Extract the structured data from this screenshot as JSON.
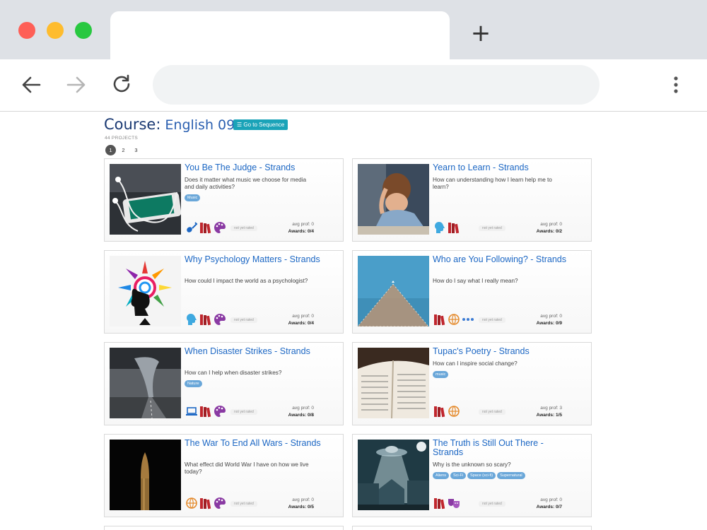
{
  "course": {
    "label": "Course:",
    "name": "English 09",
    "sequence_button": "☰ Go to Sequence",
    "project_count": "44 PROJECTS"
  },
  "pagination": [
    "1",
    "2",
    "3"
  ],
  "cards": [
    {
      "title": "You Be The Judge - Strands",
      "question": "Does it matter what music we choose for media and daily activities?",
      "tags": [
        "Music"
      ],
      "icons": [
        "guitar-icon",
        "books-icon",
        "palette-icon"
      ],
      "status": "not yet rated",
      "avg_prof": "avg prof: 0",
      "awards": "Awards: 0/4"
    },
    {
      "title": "Yearn to Learn - Strands",
      "question": "How can understanding how I learn help me to learn?",
      "tags": [],
      "icons": [
        "head-icon",
        "books-icon"
      ],
      "status": "not yet rated",
      "avg_prof": "avg prof: 0",
      "awards": "Awards: 0/2"
    },
    {
      "title": "Why Psychology Matters - Strands",
      "question": "How could I impact the world as a psychologist?",
      "tags": [],
      "icons": [
        "head-icon",
        "books-icon",
        "palette-icon"
      ],
      "status": "not yet rated",
      "avg_prof": "avg prof: 0",
      "awards": "Awards: 0/4"
    },
    {
      "title": "Who are You Following? - Strands",
      "question": "How do I say what I really mean?",
      "tags": [],
      "icons": [
        "books-icon",
        "globe-icon",
        "more-icon"
      ],
      "status": "not yet rated",
      "avg_prof": "avg prof: 0",
      "awards": "Awards: 0/9"
    },
    {
      "title": "When Disaster Strikes - Strands",
      "question": "How can I help when disaster strikes?",
      "tags": [
        "Nature"
      ],
      "icons": [
        "laptop-icon",
        "books-icon",
        "palette-icon"
      ],
      "status": "not yet rated",
      "avg_prof": "avg prof: 0",
      "awards": "Awards: 0/8"
    },
    {
      "title": "Tupac's Poetry - Strands",
      "question": "How can I inspire social change?",
      "tags": [
        "music"
      ],
      "icons": [
        "books-icon",
        "globe-icon"
      ],
      "status": "not yet rated",
      "avg_prof": "avg prof: 3",
      "awards": "Awards: 1/5"
    },
    {
      "title": "The War To End All Wars - Strands",
      "question": "What effect did World War I have on how we live today?",
      "tags": [],
      "icons": [
        "globe-icon",
        "books-icon",
        "palette-icon"
      ],
      "status": "not yet rated",
      "avg_prof": "avg prof: 0",
      "awards": "Awards: 0/5"
    },
    {
      "title": "The Truth is Still Out There - Strands",
      "question": "Why is the unknown so scary?",
      "tags": [
        "Aliens",
        "Sci-Fi",
        "Space (sci-fi)",
        "Supernatural"
      ],
      "icons": [
        "books-icon",
        "theater-masks-icon"
      ],
      "status": "not yet rated",
      "avg_prof": "avg prof: 0",
      "awards": "Awards: 0/7"
    }
  ]
}
